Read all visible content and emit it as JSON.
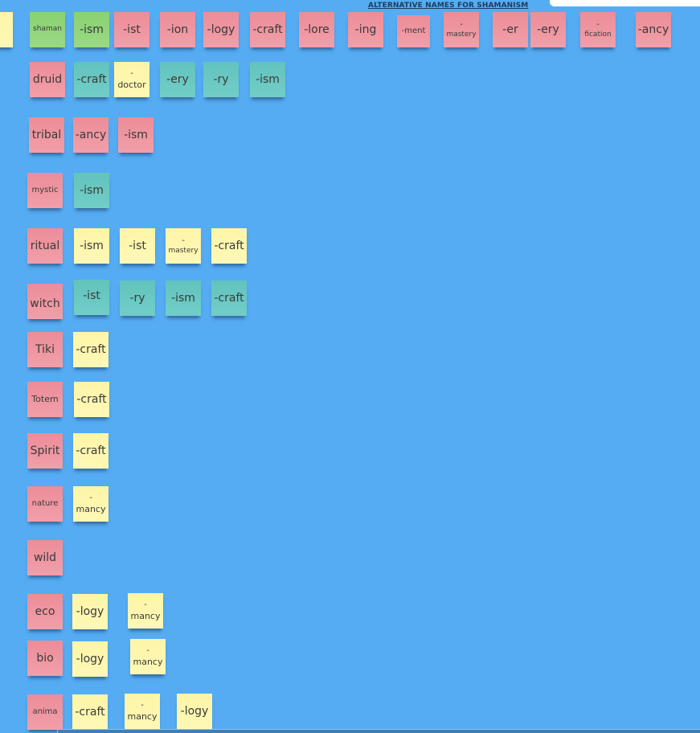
{
  "board": {
    "title": "ALTERNATIVE NAMES FOR SHAMANISM",
    "background_color": "#55acf2",
    "note_colors": {
      "red": "#ee939e",
      "green": "#8fd47a",
      "teal": "#68c8c2",
      "yellow": "#fef6ad"
    }
  },
  "notes": {
    "edge": {
      "text": "",
      "color": "yellow"
    },
    "r1": [
      {
        "text": "shaman",
        "color": "green"
      },
      {
        "text": "-ism",
        "color": "green"
      },
      {
        "text": "-ist",
        "color": "red"
      },
      {
        "text": "-ion",
        "color": "red"
      },
      {
        "text": "-logy",
        "color": "red"
      },
      {
        "text": "-craft",
        "color": "red"
      },
      {
        "text": "-lore",
        "color": "red"
      },
      {
        "text": "-ing",
        "color": "red"
      },
      {
        "text": "-ment",
        "color": "red"
      },
      {
        "dash": "-",
        "text": "mastery",
        "color": "red"
      },
      {
        "text": "-er",
        "color": "red"
      },
      {
        "text": "-ery",
        "color": "red"
      },
      {
        "dash": "-",
        "text": "fication",
        "color": "red"
      },
      {
        "text": "-ancy",
        "color": "red"
      }
    ],
    "r2": [
      {
        "text": "druid",
        "color": "red"
      },
      {
        "text": "-craft",
        "color": "teal"
      },
      {
        "dash": "-",
        "text": "doctor",
        "color": "yellow"
      },
      {
        "text": "-ery",
        "color": "teal"
      },
      {
        "text": "-ry",
        "color": "teal"
      },
      {
        "text": "-ism",
        "color": "teal"
      }
    ],
    "r3": [
      {
        "text": "tribal",
        "color": "red"
      },
      {
        "text": "-ancy",
        "color": "red"
      },
      {
        "text": "-ism",
        "color": "red"
      }
    ],
    "r4": [
      {
        "text": "mystic",
        "color": "red"
      },
      {
        "text": "-ism",
        "color": "teal"
      }
    ],
    "r5": [
      {
        "text": "ritual",
        "color": "red"
      },
      {
        "text": "-ism",
        "color": "yellow"
      },
      {
        "text": "-ist",
        "color": "yellow"
      },
      {
        "dash": "-",
        "text": "mastery",
        "color": "yellow"
      },
      {
        "text": "-craft",
        "color": "yellow"
      }
    ],
    "r6": [
      {
        "text": "witch",
        "color": "red"
      },
      {
        "text": "-ist",
        "color": "teal"
      },
      {
        "text": "-ry",
        "color": "teal"
      },
      {
        "text": "-ism",
        "color": "teal"
      },
      {
        "text": "-craft",
        "color": "teal"
      }
    ],
    "r7": [
      {
        "text": "Tiki",
        "color": "red"
      },
      {
        "text": "-craft",
        "color": "yellow"
      }
    ],
    "r8": [
      {
        "text": "Totem",
        "color": "red"
      },
      {
        "text": "-craft",
        "color": "yellow"
      }
    ],
    "r9": [
      {
        "text": "Spirit",
        "color": "red"
      },
      {
        "text": "-craft",
        "color": "yellow"
      }
    ],
    "r10": [
      {
        "text": "nature",
        "color": "red"
      },
      {
        "dash": "-",
        "text": "mancy",
        "color": "yellow"
      }
    ],
    "r11": [
      {
        "text": "wild",
        "color": "red"
      }
    ],
    "r12": [
      {
        "text": "eco",
        "color": "red"
      },
      {
        "text": "-logy",
        "color": "yellow"
      },
      {
        "dash": "-",
        "text": "mancy",
        "color": "yellow"
      }
    ],
    "r13": [
      {
        "text": "bio",
        "color": "red"
      },
      {
        "text": "-logy",
        "color": "yellow"
      },
      {
        "dash": "-",
        "text": "mancy",
        "color": "yellow"
      }
    ],
    "r14": [
      {
        "text": "anima",
        "color": "red"
      },
      {
        "text": "-craft",
        "color": "yellow"
      },
      {
        "dash": "-",
        "text": "mancy",
        "color": "yellow"
      },
      {
        "text": "-logy",
        "color": "yellow"
      }
    ]
  }
}
